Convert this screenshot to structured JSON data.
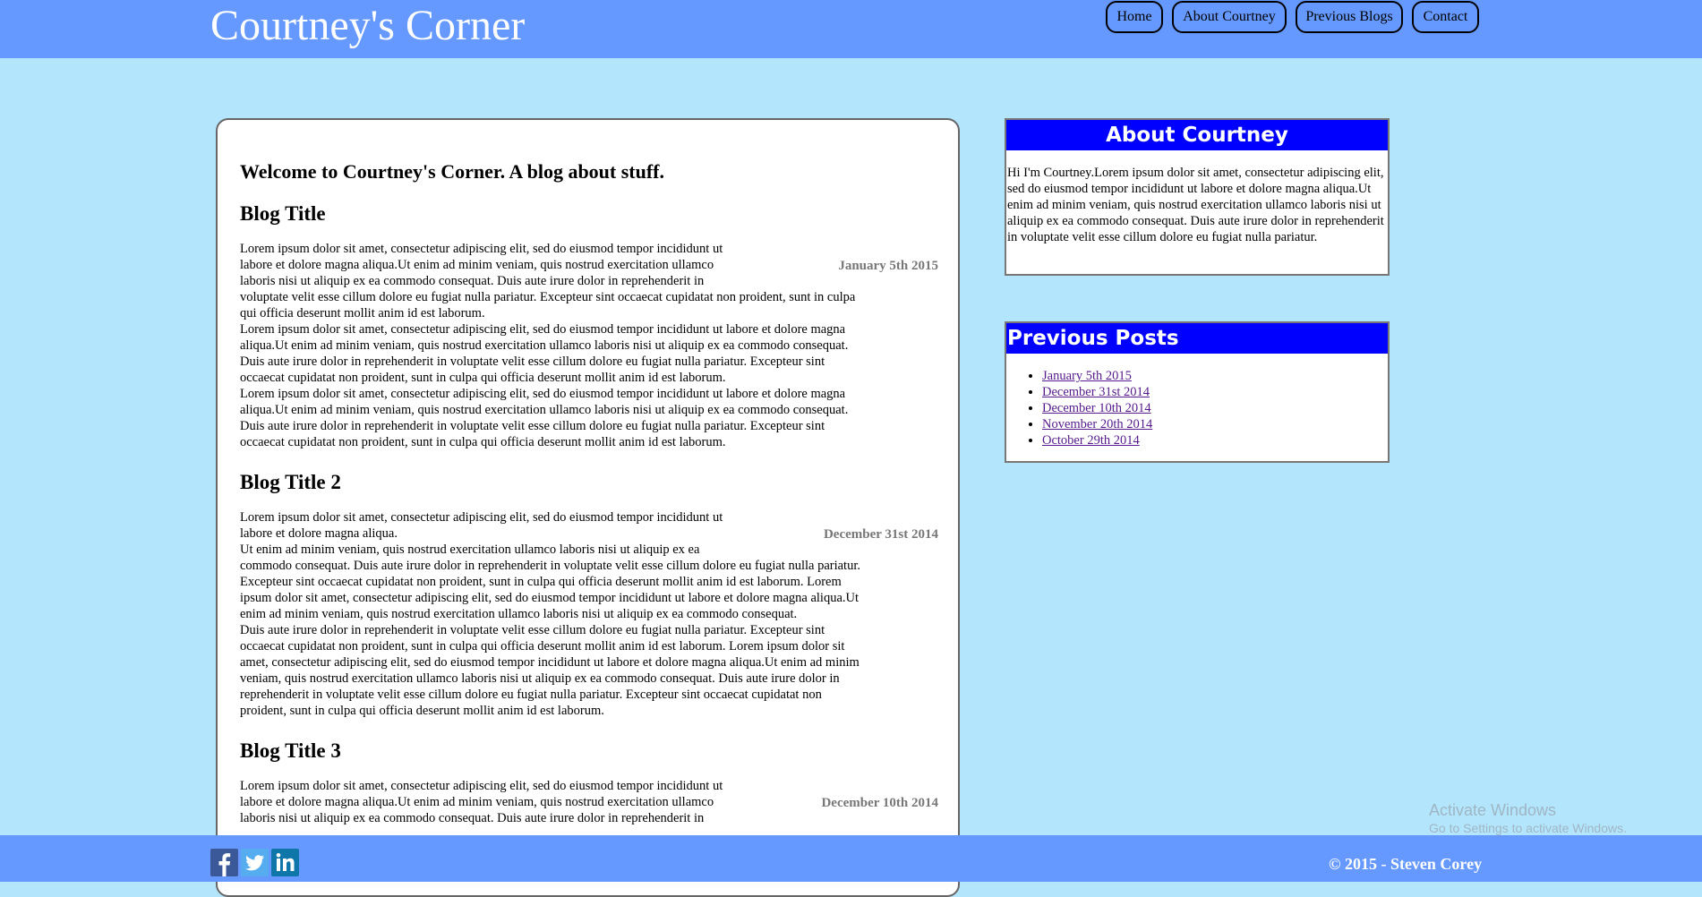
{
  "header": {
    "site_title": "Courtney's Corner",
    "nav": [
      "Home",
      "About Courtney",
      "Previous Blogs",
      "Contact"
    ]
  },
  "main": {
    "welcome": "Welcome to Courtney's Corner. A blog about stuff.",
    "posts": [
      {
        "title": "Blog Title",
        "date": "January 5th 2015",
        "lines": [
          "Lorem ipsum dolor sit amet, consectetur adipiscing elit, sed do eiusmod tempor incididunt ut",
          "labore et dolore magna aliqua.Ut enim ad minim veniam, quis nostrud exercitation ullamco",
          "laboris nisi ut aliquip ex ea commodo consequat. Duis aute irure dolor in reprehenderit in",
          "voluptate velit esse cillum dolore eu fugiat nulla pariatur. Excepteur sint occaecat cupidatat non proident, sunt in culpa",
          "qui officia deserunt mollit anim id est laborum.",
          "Lorem ipsum dolor sit amet, consectetur adipiscing elit, sed do eiusmod tempor incididunt ut labore et dolore magna",
          "aliqua.Ut enim ad minim veniam, quis nostrud exercitation ullamco laboris nisi ut aliquip ex ea commodo consequat.",
          "Duis aute irure dolor in reprehenderit in voluptate velit esse cillum dolore eu fugiat nulla pariatur. Excepteur sint",
          "occaecat cupidatat non proident, sunt in culpa qui officia deserunt mollit anim id est laborum.",
          "Lorem ipsum dolor sit amet, consectetur adipiscing elit, sed do eiusmod tempor incididunt ut labore et dolore magna",
          "aliqua.Ut enim ad minim veniam, quis nostrud exercitation ullamco laboris nisi ut aliquip ex ea commodo consequat.",
          "Duis aute irure dolor in reprehenderit in voluptate velit esse cillum dolore eu fugiat nulla pariatur. Excepteur sint",
          "occaecat cupidatat non proident, sunt in culpa qui officia deserunt mollit anim id est laborum."
        ]
      },
      {
        "title": "Blog Title 2",
        "date": "December 31st 2014",
        "lines": [
          "Lorem ipsum dolor sit amet, consectetur adipiscing elit, sed do eiusmod tempor incididunt ut",
          "labore et dolore magna aliqua.",
          "Ut enim ad minim veniam, quis nostrud exercitation ullamco laboris nisi ut aliquip ex ea",
          "commodo consequat. Duis aute irure dolor in reprehenderit in voluptate velit esse cillum dolore eu fugiat nulla pariatur.",
          "Excepteur sint occaecat cupidatat non proident, sunt in culpa qui officia deserunt mollit anim id est laborum. Lorem",
          "ipsum dolor sit amet, consectetur adipiscing elit, sed do eiusmod tempor incididunt ut labore et dolore magna aliqua.Ut",
          "enim ad minim veniam, quis nostrud exercitation ullamco laboris nisi ut aliquip ex ea commodo consequat.",
          "Duis aute irure dolor in reprehenderit in voluptate velit esse cillum dolore eu fugiat nulla pariatur. Excepteur sint",
          "occaecat cupidatat non proident, sunt in culpa qui officia deserunt mollit anim id est laborum. Lorem ipsum dolor sit",
          "amet, consectetur adipiscing elit, sed do eiusmod tempor incididunt ut labore et dolore magna aliqua.Ut enim ad minim",
          "veniam, quis nostrud exercitation ullamco laboris nisi ut aliquip ex ea commodo consequat. Duis aute irure dolor in",
          "reprehenderit in voluptate velit esse cillum dolore eu fugiat nulla pariatur. Excepteur sint occaecat cupidatat non",
          "proident, sunt in culpa qui officia deserunt mollit anim id est laborum."
        ]
      },
      {
        "title": "Blog Title 3",
        "date": "December 10th 2014",
        "lines": [
          "Lorem ipsum dolor sit amet, consectetur adipiscing elit, sed do eiusmod tempor incididunt ut",
          "labore et dolore magna aliqua.Ut enim ad minim veniam, quis nostrud exercitation ullamco",
          "laboris nisi ut aliquip ex ea commodo consequat. Duis aute irure dolor in reprehenderit in"
        ]
      }
    ]
  },
  "sidebar": {
    "about_title": "About Courtney",
    "about_text": "Hi I'm Courtney.Lorem ipsum dolor sit amet, consectetur adipiscing elit, sed do eiusmod tempor incididunt ut labore et dolore magna aliqua.Ut enim ad minim veniam, quis nostrud exercitation ullamco laboris nisi ut aliquip ex ea commodo consequat. Duis aute irure dolor in reprehenderit in voluptate velit esse cillum dolore eu fugiat nulla pariatur.",
    "previous_title": "Previous Posts",
    "previous_posts": [
      "January 5th 2015",
      "December 31st 2014",
      "December 10th 2014",
      "November 20th 2014",
      "October 29th 2014"
    ]
  },
  "footer": {
    "copyright": "© 2015 - Steven Corey",
    "social_icons": [
      "facebook-icon",
      "twitter-icon",
      "linkedin-icon"
    ]
  },
  "os_watermark": {
    "line1": "Activate Windows",
    "line2": "Go to Settings to activate Windows."
  },
  "colors": {
    "page_bg": "#b3e5fc",
    "header_bg": "#6699ff",
    "sidebar_head_bg": "#0000ff",
    "date_color": "#777777",
    "link_color": "#551a8b"
  }
}
